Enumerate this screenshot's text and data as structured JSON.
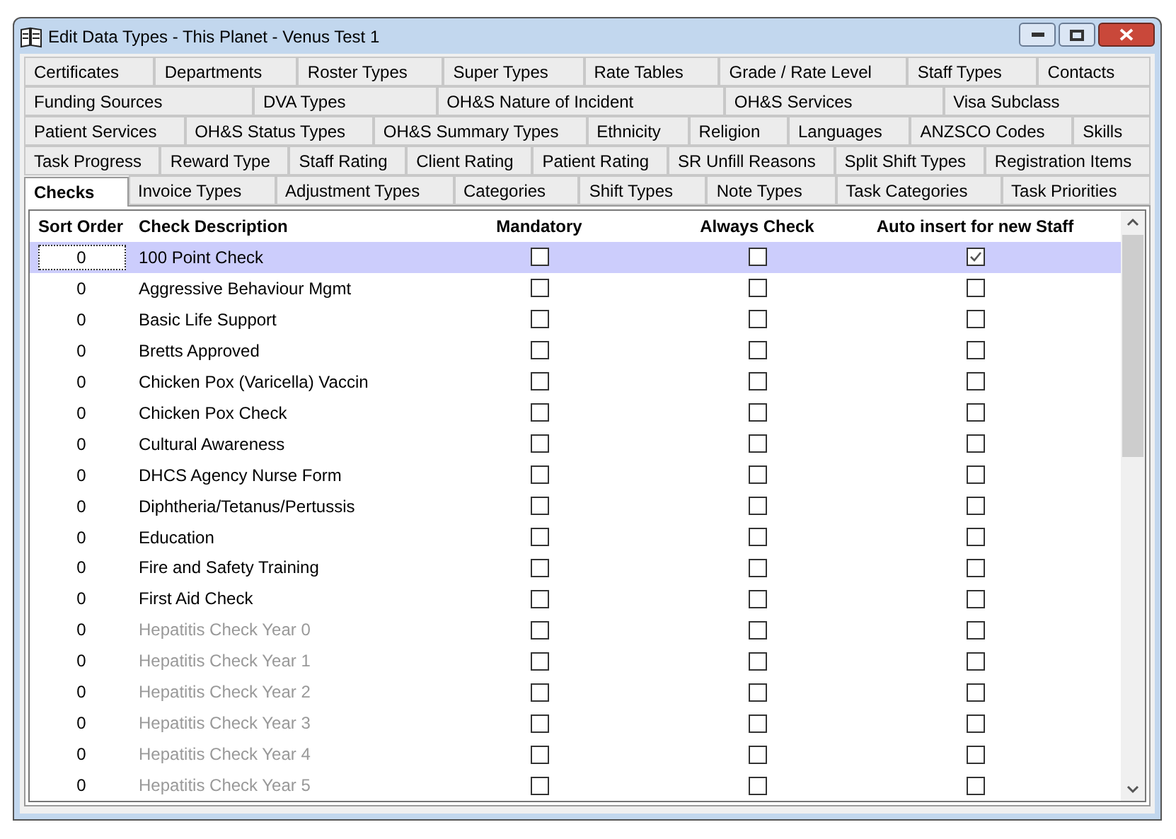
{
  "window": {
    "title": "Edit Data Types  -  This Planet - Venus Test 1"
  },
  "tab_rows": [
    [
      {
        "label": "Certificates",
        "selected": false
      },
      {
        "label": "Departments",
        "selected": false
      },
      {
        "label": "Roster Types",
        "selected": false
      },
      {
        "label": "Super Types",
        "selected": false
      },
      {
        "label": "Rate Tables",
        "selected": false
      },
      {
        "label": "Grade / Rate Level",
        "selected": false
      },
      {
        "label": "Staff Types",
        "selected": false
      },
      {
        "label": "Contacts",
        "selected": false
      }
    ],
    [
      {
        "label": "Funding Sources",
        "selected": false
      },
      {
        "label": "DVA Types",
        "selected": false
      },
      {
        "label": "OH&S Nature of Incident",
        "selected": false
      },
      {
        "label": "OH&S Services",
        "selected": false
      },
      {
        "label": "Visa Subclass",
        "selected": false
      }
    ],
    [
      {
        "label": "Patient Services",
        "selected": false
      },
      {
        "label": "OH&S Status Types",
        "selected": false
      },
      {
        "label": "OH&S Summary Types",
        "selected": false
      },
      {
        "label": "Ethnicity",
        "selected": false
      },
      {
        "label": "Religion",
        "selected": false
      },
      {
        "label": "Languages",
        "selected": false
      },
      {
        "label": "ANZSCO Codes",
        "selected": false
      },
      {
        "label": "Skills",
        "selected": false
      }
    ],
    [
      {
        "label": "Task Progress",
        "selected": false
      },
      {
        "label": "Reward Type",
        "selected": false
      },
      {
        "label": "Staff Rating",
        "selected": false
      },
      {
        "label": "Client Rating",
        "selected": false
      },
      {
        "label": "Patient Rating",
        "selected": false
      },
      {
        "label": "SR Unfill Reasons",
        "selected": false
      },
      {
        "label": "Split Shift Types",
        "selected": false
      },
      {
        "label": "Registration Items",
        "selected": false
      }
    ],
    [
      {
        "label": "Checks",
        "selected": true
      },
      {
        "label": "Invoice Types",
        "selected": false
      },
      {
        "label": "Adjustment Types",
        "selected": false
      },
      {
        "label": "Categories",
        "selected": false
      },
      {
        "label": "Shift Types",
        "selected": false
      },
      {
        "label": "Note Types",
        "selected": false
      },
      {
        "label": "Task Categories",
        "selected": false
      },
      {
        "label": "Task Priorities",
        "selected": false
      }
    ]
  ],
  "table": {
    "columns": [
      "Sort Order",
      "Check Description",
      "Mandatory",
      "Always Check",
      "Auto insert for new Staff"
    ],
    "rows": [
      {
        "sort_order": "0",
        "description": "100 Point Check",
        "mandatory": false,
        "always_check": false,
        "auto_insert": true,
        "selected": true,
        "greyed": false
      },
      {
        "sort_order": "0",
        "description": "Aggressive Behaviour Mgmt",
        "mandatory": false,
        "always_check": false,
        "auto_insert": false,
        "selected": false,
        "greyed": false
      },
      {
        "sort_order": "0",
        "description": "Basic Life Support",
        "mandatory": false,
        "always_check": false,
        "auto_insert": false,
        "selected": false,
        "greyed": false
      },
      {
        "sort_order": "0",
        "description": "Bretts Approved",
        "mandatory": false,
        "always_check": false,
        "auto_insert": false,
        "selected": false,
        "greyed": false
      },
      {
        "sort_order": "0",
        "description": "Chicken Pox (Varicella) Vaccin",
        "mandatory": false,
        "always_check": false,
        "auto_insert": false,
        "selected": false,
        "greyed": false
      },
      {
        "sort_order": "0",
        "description": "Chicken Pox Check",
        "mandatory": false,
        "always_check": false,
        "auto_insert": false,
        "selected": false,
        "greyed": false
      },
      {
        "sort_order": "0",
        "description": "Cultural Awareness",
        "mandatory": false,
        "always_check": false,
        "auto_insert": false,
        "selected": false,
        "greyed": false
      },
      {
        "sort_order": "0",
        "description": "DHCS Agency Nurse Form",
        "mandatory": false,
        "always_check": false,
        "auto_insert": false,
        "selected": false,
        "greyed": false
      },
      {
        "sort_order": "0",
        "description": "Diphtheria/Tetanus/Pertussis",
        "mandatory": false,
        "always_check": false,
        "auto_insert": false,
        "selected": false,
        "greyed": false
      },
      {
        "sort_order": "0",
        "description": "Education",
        "mandatory": false,
        "always_check": false,
        "auto_insert": false,
        "selected": false,
        "greyed": false
      },
      {
        "sort_order": "0",
        "description": "Fire and Safety Training",
        "mandatory": false,
        "always_check": false,
        "auto_insert": false,
        "selected": false,
        "greyed": false
      },
      {
        "sort_order": "0",
        "description": "First Aid Check",
        "mandatory": false,
        "always_check": false,
        "auto_insert": false,
        "selected": false,
        "greyed": false
      },
      {
        "sort_order": "0",
        "description": "Hepatitis Check Year 0",
        "mandatory": false,
        "always_check": false,
        "auto_insert": false,
        "selected": false,
        "greyed": true
      },
      {
        "sort_order": "0",
        "description": "Hepatitis Check Year 1",
        "mandatory": false,
        "always_check": false,
        "auto_insert": false,
        "selected": false,
        "greyed": true
      },
      {
        "sort_order": "0",
        "description": "Hepatitis Check Year 2",
        "mandatory": false,
        "always_check": false,
        "auto_insert": false,
        "selected": false,
        "greyed": true
      },
      {
        "sort_order": "0",
        "description": "Hepatitis Check Year 3",
        "mandatory": false,
        "always_check": false,
        "auto_insert": false,
        "selected": false,
        "greyed": true
      },
      {
        "sort_order": "0",
        "description": "Hepatitis Check Year 4",
        "mandatory": false,
        "always_check": false,
        "auto_insert": false,
        "selected": false,
        "greyed": true
      },
      {
        "sort_order": "0",
        "description": "Hepatitis Check Year 5",
        "mandatory": false,
        "always_check": false,
        "auto_insert": false,
        "selected": false,
        "greyed": true
      }
    ]
  }
}
